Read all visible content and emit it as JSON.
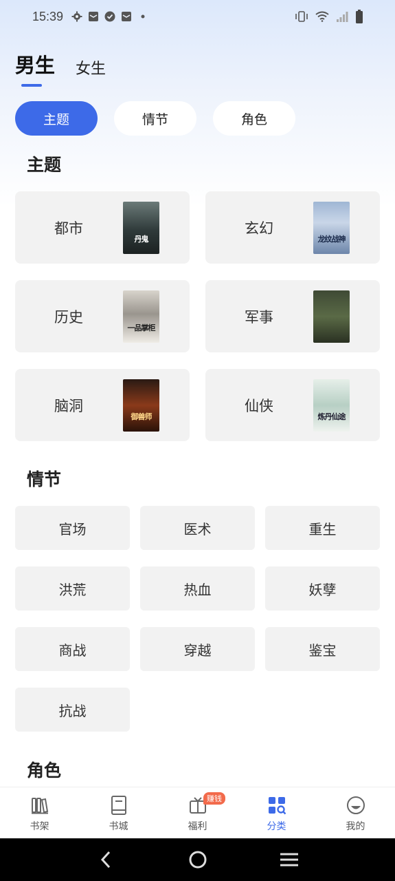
{
  "status_bar": {
    "time": "15:39"
  },
  "gender_tabs": [
    {
      "label": "男生",
      "active": true
    },
    {
      "label": "女生",
      "active": false
    }
  ],
  "segments": [
    {
      "label": "主题",
      "active": true
    },
    {
      "label": "情节",
      "active": false
    },
    {
      "label": "角色",
      "active": false
    }
  ],
  "sections": {
    "theme_title": "主题",
    "plot_title": "情节",
    "role_title": "角色"
  },
  "themes": [
    {
      "label": "都市",
      "cover_text": "丹鬼"
    },
    {
      "label": "玄幻",
      "cover_text": "龙纹战神"
    },
    {
      "label": "历史",
      "cover_text": "一品掌柜"
    },
    {
      "label": "军事",
      "cover_text": ""
    },
    {
      "label": "脑洞",
      "cover_text": "御兽师"
    },
    {
      "label": "仙侠",
      "cover_text": "炼丹仙途"
    }
  ],
  "plots": [
    "官场",
    "医术",
    "重生",
    "洪荒",
    "热血",
    "妖孽",
    "商战",
    "穿越",
    "鉴宝",
    "抗战"
  ],
  "tabbar": {
    "items": [
      {
        "label": "书架",
        "icon": "bookshelf-icon",
        "active": false
      },
      {
        "label": "书城",
        "icon": "book-store-icon",
        "active": false
      },
      {
        "label": "福利",
        "icon": "gift-icon",
        "active": false
      },
      {
        "label": "分类",
        "icon": "category-icon",
        "active": true
      },
      {
        "label": "我的",
        "icon": "profile-icon",
        "active": false
      }
    ],
    "welfare_badge": "赚钱"
  },
  "colors": {
    "accent": "#3d6ae8",
    "badge": "#f26a4b",
    "card_bg": "#f2f2f2"
  }
}
